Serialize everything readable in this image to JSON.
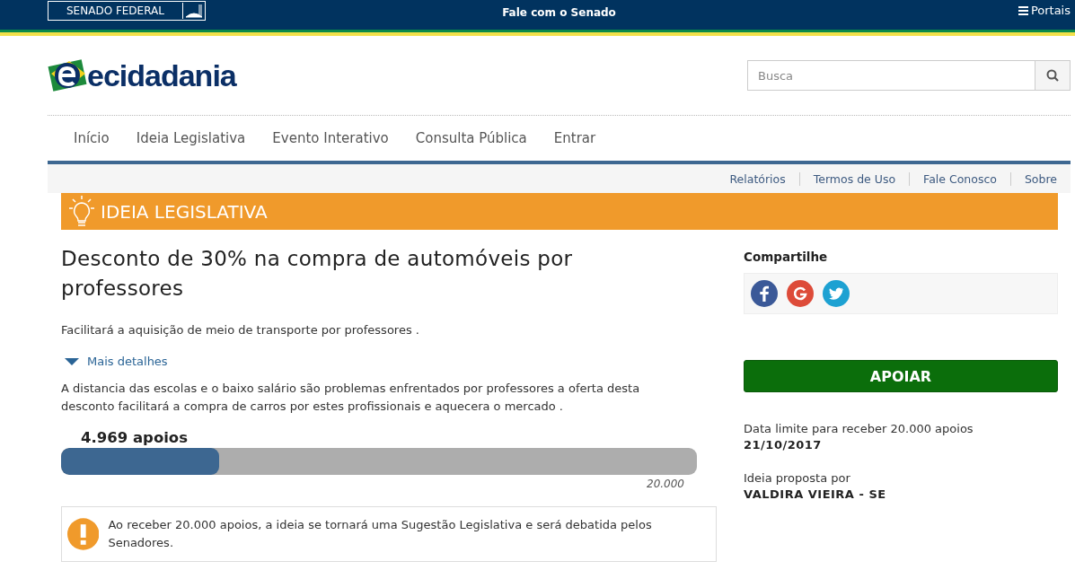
{
  "topbar": {
    "brand": "SENADO FEDERAL",
    "center_link": "Fale com o Senado",
    "menu": "Portais"
  },
  "header": {
    "logo": "ecidadania",
    "search": {
      "placeholder": "Busca"
    }
  },
  "nav": [
    "Início",
    "Ideia Legislativa",
    "Evento Interativo",
    "Consulta Pública",
    "Entrar"
  ],
  "subnav": [
    "Relatórios",
    "Termos de Uso",
    "Fale Conosco",
    "Sobre"
  ],
  "section_title": "IDEIA LEGISLATIVA",
  "idea": {
    "title": "Desconto de 30% na compra de automóveis por professores",
    "summary": "Facilitará a aquisição de meio de transporte por professores .",
    "details_toggle": {
      "label": "Mais detalhes",
      "expanded": true
    },
    "details": "A distancia das escolas e o baixo salário são problemas enfrentados por professores a oferta desta desconto facilitará a compra de carros por estes profissionais e aquecera o mercado .",
    "support_count": "4.969 apoios",
    "level": 0.248,
    "goal": "20.000",
    "notice": "Ao receber 20.000 apoios, a ideia se tornará uma Sugestão Legislativa e será debatida pelos Senadores."
  },
  "sidebar": {
    "share_title": "Compartilhe",
    "support_button": "APOIAR",
    "deadline_label": "Data limite para receber 20.000 apoios",
    "deadline": "21/10/2017",
    "author_label": "Ideia proposta por",
    "author": "VALDIRA VIEIRA - SE"
  }
}
